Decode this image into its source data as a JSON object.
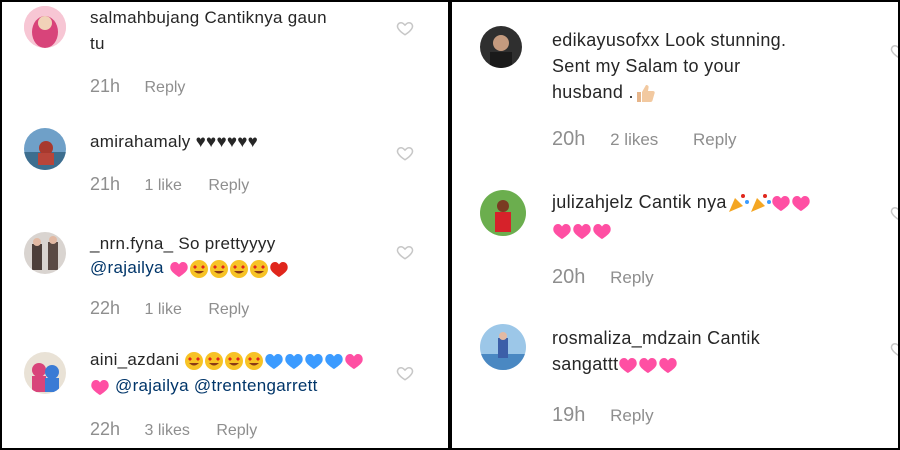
{
  "left": [
    {
      "username": "salmahbujang",
      "text1": "Cantiknya gaun",
      "text2": "tu",
      "time": "21h",
      "likes": "",
      "reply": "Reply"
    },
    {
      "username": "amirahamaly",
      "text1": "♥♥♥♥♥♥",
      "time": "21h",
      "likes": "1 like",
      "reply": "Reply"
    },
    {
      "username": "_nrn.fyna_",
      "text1": "So prettyyyy",
      "mention": "@rajailya",
      "time": "22h",
      "likes": "1 like",
      "reply": "Reply"
    },
    {
      "username": "aini_azdani",
      "mention1": "@rajailya",
      "mention2": "@trentengarrett",
      "time": "22h",
      "likes": "3 likes",
      "reply": "Reply"
    }
  ],
  "right": [
    {
      "username": "edikayusofxx",
      "text1": "Look stunning.",
      "text2": "Sent my Salam to your",
      "text3": "husband .",
      "time": "20h",
      "likes": "2 likes",
      "reply": "Reply"
    },
    {
      "username": "julizahjelz",
      "text1": "Cantik nya",
      "time": "20h",
      "likes": "",
      "reply": "Reply"
    },
    {
      "username": "rosmaliza_mdzain",
      "text1": "Cantik",
      "text2": "sangattt",
      "time": "19h",
      "likes": "",
      "reply": "Reply"
    }
  ],
  "colors": {
    "divider": "#000000",
    "text": "#262626",
    "meta": "#8e8e8e",
    "mention": "#003569",
    "heart_emoji": "#ff4fa3",
    "blue_heart": "#3b9bff",
    "red_heart": "#e0261c"
  },
  "icons": [
    "heart-outline-icon",
    "sparkling-heart-icon",
    "smiling-face-heart-eyes-icon",
    "party-popper-icon",
    "thumbs-up-icon"
  ]
}
